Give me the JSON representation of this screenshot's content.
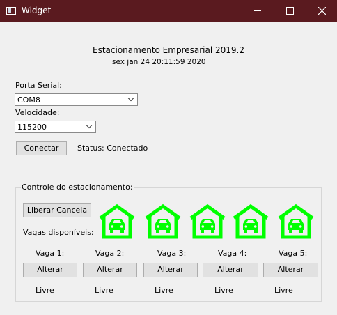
{
  "window": {
    "title": "Widget"
  },
  "header": {
    "title": "Estacionamento Empresarial 2019.2",
    "datetime": "sex jan 24 20:11:59 2020"
  },
  "serial": {
    "port_label": "Porta Serial:",
    "port_value": "COM8",
    "speed_label": "Velocidade:",
    "speed_value": "115200",
    "connect_label": "Conectar",
    "status_text": "Status: Conectado"
  },
  "control": {
    "group_title": "Controle do estacionamento:",
    "release_label": "Liberar Cancela",
    "available_label": "Vagas disponíveis:",
    "garage_color": "#00ff00",
    "spots": [
      {
        "label": "Vaga 1:",
        "button": "Alterar",
        "status": "Livre"
      },
      {
        "label": "Vaga 2:",
        "button": "Alterar",
        "status": "Livre"
      },
      {
        "label": "Vaga 3:",
        "button": "Alterar",
        "status": "Livre"
      },
      {
        "label": "Vaga 4:",
        "button": "Alterar",
        "status": "Livre"
      },
      {
        "label": "Vaga 5:",
        "button": "Alterar",
        "status": "Livre"
      }
    ]
  }
}
